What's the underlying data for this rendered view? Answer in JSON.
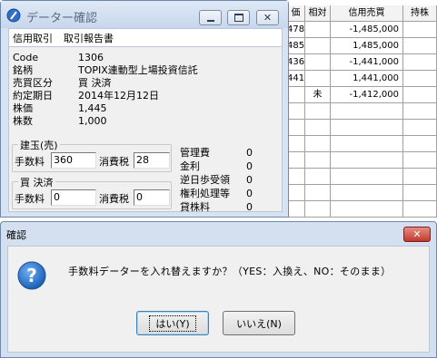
{
  "sheet": {
    "headers": [
      "価",
      "相対",
      "信用売買",
      "持株"
    ],
    "rows": [
      {
        "c0": "478",
        "c1": "",
        "c2": "-1,485,000",
        "c3": ""
      },
      {
        "c0": "485",
        "c1": "",
        "c2": "1,485,000",
        "c3": ""
      },
      {
        "c0": "436",
        "c1": "",
        "c2": "-1,441,000",
        "c3": ""
      },
      {
        "c0": "441",
        "c1": "",
        "c2": "1,441,000",
        "c3": ""
      },
      {
        "c0": "",
        "c1": "未",
        "c2": "-1,412,000",
        "c3": ""
      },
      {
        "c0": "",
        "c1": "",
        "c2": "",
        "c3": ""
      },
      {
        "c0": "",
        "c1": "",
        "c2": "",
        "c3": ""
      },
      {
        "c0": "",
        "c1": "",
        "c2": "",
        "c3": ""
      },
      {
        "c0": "",
        "c1": "",
        "c2": "",
        "c3": ""
      },
      {
        "c0": "",
        "c1": "",
        "c2": "",
        "c3": ""
      },
      {
        "c0": "",
        "c1": "",
        "c2": "",
        "c3": ""
      },
      {
        "c0": "",
        "c1": "",
        "c2": "",
        "c3": ""
      }
    ]
  },
  "data_window": {
    "title": "データー確認",
    "menu": [
      "信用取引",
      "取引報告書"
    ],
    "info": [
      {
        "label": "Code",
        "value": "1306"
      },
      {
        "label": "銘柄",
        "value": "TOPIX連動型上場投資信託"
      },
      {
        "label": "売買区分",
        "value": "買 決済"
      },
      {
        "label": "約定期日",
        "value": "2014年12月12日"
      },
      {
        "label": "株価",
        "value": "1,445"
      },
      {
        "label": "株数",
        "value": "1,000"
      }
    ],
    "open_group": {
      "title": "建玉(売)",
      "fee_label": "手数料",
      "fee_value": "360",
      "tax_label": "消費税",
      "tax_value": "28"
    },
    "close_group": {
      "title": "買 決済",
      "fee_label": "手数料",
      "fee_value": "0",
      "tax_label": "消費税",
      "tax_value": "0"
    },
    "fees": [
      {
        "label": "管理費",
        "value": "0"
      },
      {
        "label": "金利",
        "value": "0"
      },
      {
        "label": "逆日歩受領",
        "value": "0"
      },
      {
        "label": "権利処理等",
        "value": "0"
      },
      {
        "label": "貸株料",
        "value": "0"
      }
    ]
  },
  "dialog": {
    "title": "確認",
    "message": "手数料データーを入れ替えますか？（YES：入換え、NO：そのまま）",
    "yes_label": "はい(Y)",
    "no_label": "いいえ(N)",
    "icon": "question-icon"
  },
  "colors": {
    "title_text": "#5a6b80",
    "accent": "#3c7fb1",
    "close_red": "#c3392b"
  }
}
